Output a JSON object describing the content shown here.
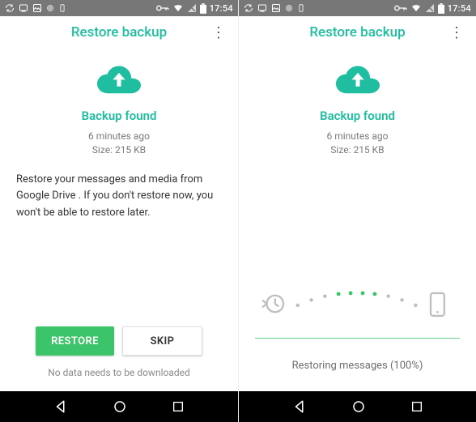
{
  "status": {
    "clock": "17:54"
  },
  "accent": "#1fbea0",
  "left": {
    "title": "Restore backup",
    "found": "Backup found",
    "meta_time": "6 minutes ago",
    "meta_size": "Size: 215 KB",
    "description": "Restore your messages and media from Google Drive . If you don't restore now, you won't be able to restore later.",
    "restore_label": "RESTORE",
    "skip_label": "SKIP",
    "footer": "No data needs to be downloaded"
  },
  "right": {
    "title": "Restore backup",
    "found": "Backup found",
    "meta_time": "6 minutes ago",
    "meta_size": "Size: 215 KB",
    "progress_label": "Restoring messages (100%)"
  }
}
